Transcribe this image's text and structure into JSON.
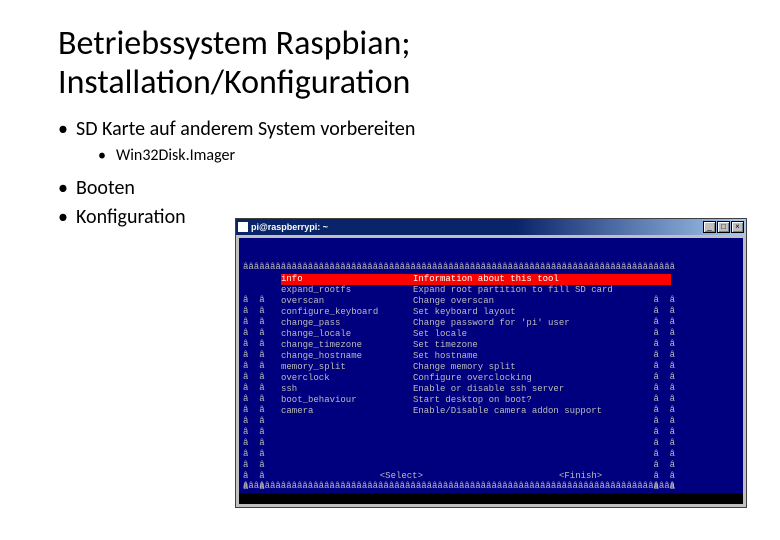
{
  "slide": {
    "title": "Betriebssystem Raspbian; Installation/Konfiguration",
    "bullet1": "SD Karte auf anderem System vorbereiten",
    "sub1": "Win32Disk.Imager",
    "bullet2": "Booten",
    "bullet3": "Konfiguration"
  },
  "window": {
    "title": "pi@raspberrypi: ~",
    "minimize": "_",
    "maximize": "□",
    "close": "×"
  },
  "terminal": {
    "row_a": "ââââââââââââââââââââââââââââââââââââââââââââââââââââââââââââââââââââââââââââââââ",
    "side_char": "â",
    "menu": [
      {
        "key": "info",
        "desc": "Information about this tool",
        "selected": true
      },
      {
        "key": "expand_rootfs",
        "desc": "Expand root partition to fill SD card"
      },
      {
        "key": "overscan",
        "desc": "Change overscan"
      },
      {
        "key": "configure_keyboard",
        "desc": "Set keyboard layout"
      },
      {
        "key": "change_pass",
        "desc": "Change password for 'pi' user"
      },
      {
        "key": "change_locale",
        "desc": "Set locale"
      },
      {
        "key": "change_timezone",
        "desc": "Set timezone"
      },
      {
        "key": "change_hostname",
        "desc": "Set hostname"
      },
      {
        "key": "memory_split",
        "desc": "Change memory split"
      },
      {
        "key": "overclock",
        "desc": "Configure overclocking"
      },
      {
        "key": "ssh",
        "desc": "Enable or disable ssh server"
      },
      {
        "key": "boot_behaviour",
        "desc": "Start desktop on boot?"
      },
      {
        "key": "camera",
        "desc": "Enable/Disable camera addon support"
      }
    ],
    "select_btn": "<Select>",
    "finish_btn": "<Finish>"
  }
}
